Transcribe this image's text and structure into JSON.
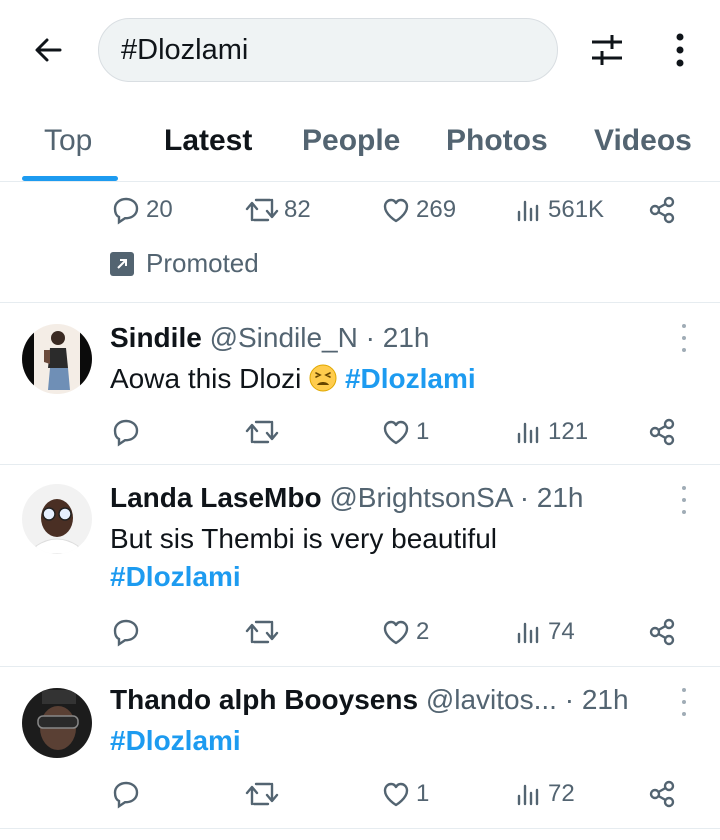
{
  "search": {
    "query": "#Dlozlami"
  },
  "tabs": [
    "Top",
    "Latest",
    "People",
    "Photos",
    "Videos"
  ],
  "promoted_tweet": {
    "replies": "20",
    "retweets": "82",
    "likes": "269",
    "views": "561K",
    "promoted_label": "Promoted"
  },
  "tweets": [
    {
      "name": "Sindile",
      "handle": "@Sindile_N",
      "time": "· 21h",
      "text": "Aowa this Dlozi",
      "emoji": "tired-face-emoji",
      "hashtag": "#Dlozlami",
      "replies": "",
      "retweets": "",
      "likes": "1",
      "views": "121"
    },
    {
      "name": "Landa LaseMbo",
      "handle": "@BrightsonSA",
      "time": "· 21h",
      "text": "But sis Thembi is very beautiful",
      "hashtag": "#Dlozlami",
      "replies": "",
      "retweets": "",
      "likes": "2",
      "views": "74"
    },
    {
      "name": "Thando alph Booysens",
      "handle": "@lavitos...",
      "time": "· 21h",
      "text": "",
      "hashtag": "#Dlozlami",
      "replies": "",
      "retweets": "",
      "likes": "1",
      "views": "72"
    }
  ],
  "colors": {
    "accent": "#1d9bf0",
    "text": "#0f1419",
    "muted": "#536471",
    "divider": "#e6ecf0"
  }
}
